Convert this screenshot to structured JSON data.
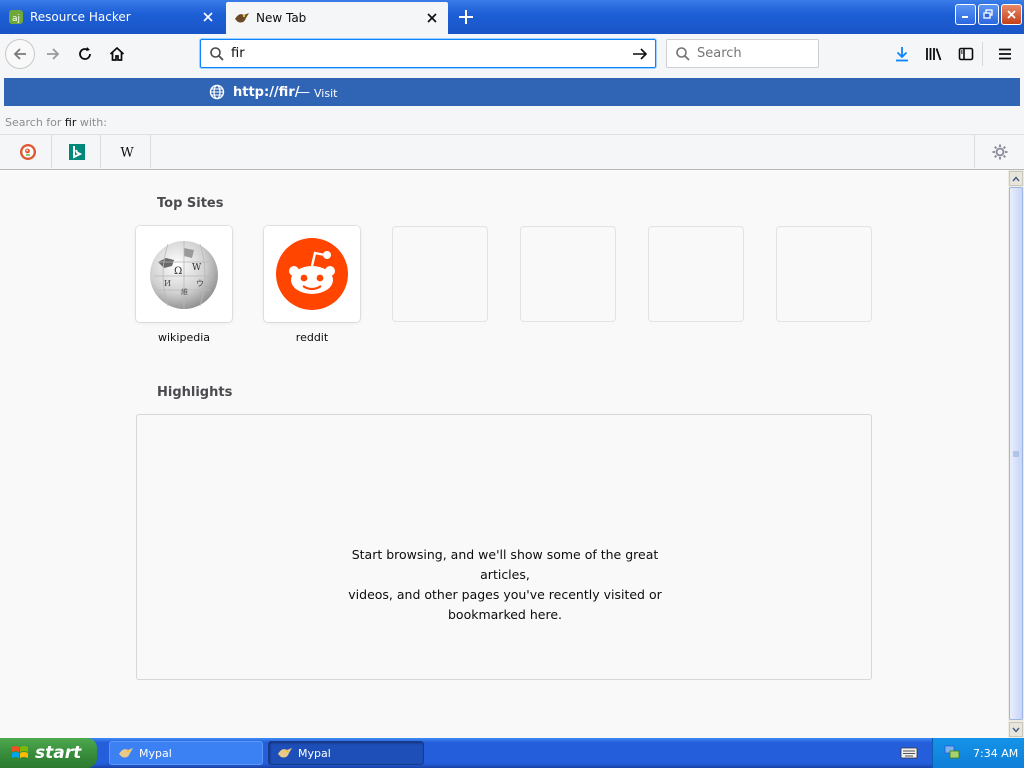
{
  "tabs": [
    {
      "label": "Resource Hacker",
      "active": false,
      "favicon": "resource-hacker-icon"
    },
    {
      "label": "New Tab",
      "active": true,
      "favicon": "mypal-icon"
    }
  ],
  "urlbar": {
    "value": "fir"
  },
  "searchbar": {
    "placeholder": "Search"
  },
  "popup": {
    "url": "http://fir/",
    "separator": "—",
    "action": "Visit",
    "search_with_prefix": "Search for ",
    "search_with_term": "fir",
    "search_with_suffix": " with:",
    "engines": [
      "duckduckgo-icon",
      "bing-icon",
      "wikipedia-icon"
    ]
  },
  "top_sites": {
    "title": "Top Sites",
    "tiles": [
      {
        "label": "wikipedia",
        "icon": "wikipedia-globe-icon"
      },
      {
        "label": "reddit",
        "icon": "reddit-icon"
      },
      {
        "label": ""
      },
      {
        "label": ""
      },
      {
        "label": ""
      },
      {
        "label": ""
      }
    ]
  },
  "highlights": {
    "title": "Highlights",
    "line1": "Start browsing, and we'll show some of the great articles,",
    "line2": "videos, and other pages you've recently visited or",
    "line3": "bookmarked here."
  },
  "taskbar": {
    "start_label": "start",
    "tasks": [
      {
        "label": "Mypal",
        "active": false
      },
      {
        "label": "Mypal",
        "active": true
      }
    ],
    "clock": "7:34 AM"
  },
  "colors": {
    "accent": "#0a84ff",
    "popup_highlight": "#3064b4",
    "reddit": "#ff4500",
    "xp_blue": "#245edb",
    "xp_green": "#388e3c"
  }
}
